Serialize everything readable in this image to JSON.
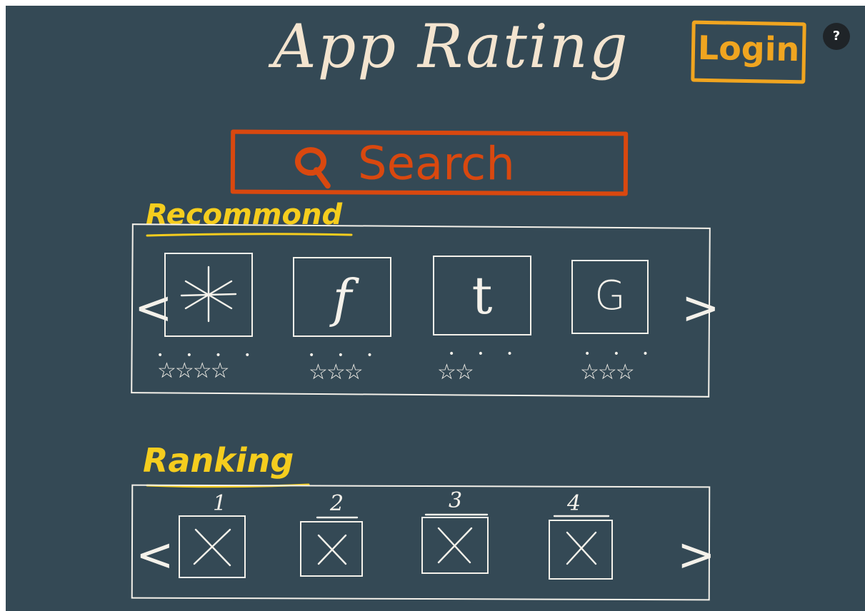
{
  "header": {
    "title": "App Rating",
    "login_label": "Login",
    "help_label": "?"
  },
  "search": {
    "label": "Search",
    "icon": "search-icon"
  },
  "recommend": {
    "title": "Recommond",
    "prev_label": "<",
    "next_label": ">",
    "apps": [
      {
        "glyph": "✳",
        "icon": "asterisk-app-icon",
        "stars": "☆☆☆☆",
        "rating": 4
      },
      {
        "glyph": "f",
        "icon": "f-app-icon",
        "stars": "☆☆☆",
        "rating": 3
      },
      {
        "glyph": "t",
        "icon": "t-app-icon",
        "stars": "☆☆",
        "rating": 2
      },
      {
        "glyph": "G",
        "icon": "g-app-icon",
        "stars": "☆☆☆",
        "rating": 3
      }
    ]
  },
  "ranking": {
    "title": "Ranking",
    "prev_label": "<",
    "next_label": ">",
    "items": [
      {
        "rank": "1",
        "icon": "placeholder-x-icon"
      },
      {
        "rank": "2",
        "icon": "placeholder-x-icon"
      },
      {
        "rank": "3",
        "icon": "placeholder-x-icon"
      },
      {
        "rank": "4",
        "icon": "placeholder-x-icon"
      }
    ]
  },
  "colors": {
    "background": "#344955",
    "title": "#f3e4cf",
    "login": "#f0a520",
    "search": "#d9480f",
    "section": "#f5cd1e",
    "ink": "#f4f1ea"
  }
}
